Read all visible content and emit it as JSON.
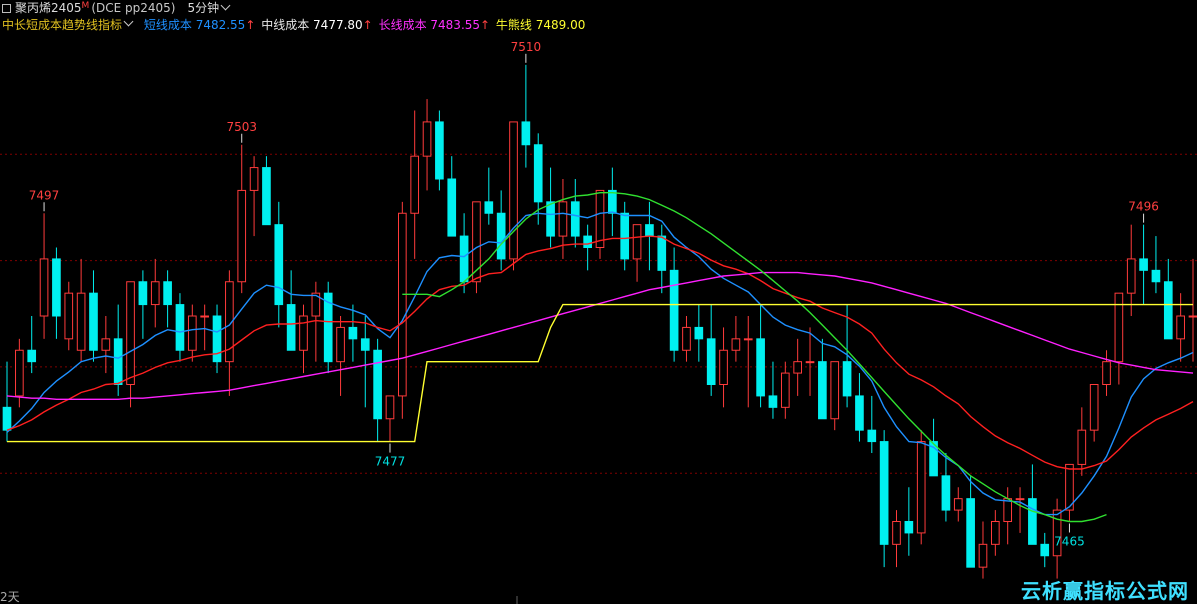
{
  "header": {
    "instrument": "聚丙烯2405",
    "flag": "M",
    "code": "(DCE pp2405)",
    "period": "5分钟"
  },
  "indicator": {
    "name": "中长短成本趋势线指标",
    "short_label": "短线成本",
    "short_value": "7482.55",
    "short_arrow": "↑",
    "mid_label": "中线成本",
    "mid_value": "7477.80",
    "mid_arrow": "↑",
    "long_label": "长线成本",
    "long_value": "7483.55",
    "long_arrow": "↑",
    "bull_label": "牛熊线",
    "bull_value": "7489.00"
  },
  "bottom_label": "2天",
  "watermark": "云析赢指标公式网",
  "colors": {
    "up": "#ff3b3b",
    "down": "#00f0f0",
    "short_line": "#1e90ff",
    "mid_line": "#ff2020",
    "long_line": "#ff20ff",
    "trend_line": "#30e030",
    "bull_line": "#ffff30",
    "grid": "#800000"
  },
  "chart_data": {
    "type": "candlestick",
    "ylim": [
      7464,
      7512
    ],
    "annotations": [
      {
        "label": "7497",
        "index": 3
      },
      {
        "label": "7503",
        "index": 19
      },
      {
        "label": "7477",
        "index": 31
      },
      {
        "label": "7510",
        "index": 42
      },
      {
        "label": "7465",
        "index": 86
      },
      {
        "label": "7496",
        "index": 92
      }
    ],
    "candles": [
      [
        7480,
        7484,
        7477,
        7478
      ],
      [
        7481,
        7486,
        7480,
        7485
      ],
      [
        7485,
        7488,
        7483,
        7484
      ],
      [
        7488,
        7497,
        7486,
        7493
      ],
      [
        7493,
        7494,
        7486,
        7488
      ],
      [
        7486,
        7491,
        7485,
        7490
      ],
      [
        7485,
        7493,
        7484,
        7490
      ],
      [
        7490,
        7492,
        7484,
        7485
      ],
      [
        7485,
        7488,
        7483,
        7486
      ],
      [
        7486,
        7489,
        7481,
        7482
      ],
      [
        7482,
        7491,
        7480,
        7491
      ],
      [
        7491,
        7492,
        7486,
        7489
      ],
      [
        7489,
        7493,
        7487,
        7491
      ],
      [
        7491,
        7492,
        7487,
        7489
      ],
      [
        7489,
        7490,
        7484,
        7485
      ],
      [
        7485,
        7489,
        7484,
        7488
      ],
      [
        7488,
        7489,
        7485,
        7488
      ],
      [
        7488,
        7489,
        7483,
        7484
      ],
      [
        7484,
        7492,
        7481,
        7491
      ],
      [
        7491,
        7503,
        7490,
        7499
      ],
      [
        7499,
        7502,
        7495,
        7501
      ],
      [
        7501,
        7502,
        7496,
        7496
      ],
      [
        7496,
        7498,
        7487,
        7489
      ],
      [
        7489,
        7492,
        7485,
        7485
      ],
      [
        7485,
        7489,
        7483,
        7488
      ],
      [
        7488,
        7491,
        7484,
        7490
      ],
      [
        7490,
        7491,
        7483,
        7484
      ],
      [
        7484,
        7488,
        7481,
        7487
      ],
      [
        7487,
        7489,
        7484,
        7486
      ],
      [
        7486,
        7488,
        7480,
        7485
      ],
      [
        7485,
        7486,
        7477,
        7479
      ],
      [
        7479,
        7481,
        7477,
        7481
      ],
      [
        7481,
        7498,
        7479,
        7497
      ],
      [
        7497,
        7506,
        7493,
        7502
      ],
      [
        7502,
        7507,
        7499,
        7505
      ],
      [
        7505,
        7506,
        7499,
        7500
      ],
      [
        7500,
        7502,
        7495,
        7495
      ],
      [
        7495,
        7497,
        7490,
        7491
      ],
      [
        7491,
        7498,
        7490,
        7498
      ],
      [
        7498,
        7501,
        7496,
        7497
      ],
      [
        7497,
        7499,
        7492,
        7493
      ],
      [
        7493,
        7505,
        7492,
        7505
      ],
      [
        7505,
        7510,
        7501,
        7503
      ],
      [
        7503,
        7504,
        7496,
        7498
      ],
      [
        7498,
        7501,
        7494,
        7495
      ],
      [
        7495,
        7500,
        7493,
        7498
      ],
      [
        7498,
        7500,
        7494,
        7495
      ],
      [
        7495,
        7496,
        7492,
        7494
      ],
      [
        7494,
        7499,
        7493,
        7499
      ],
      [
        7499,
        7501,
        7495,
        7497
      ],
      [
        7497,
        7498,
        7492,
        7493
      ],
      [
        7493,
        7496,
        7491,
        7496
      ],
      [
        7496,
        7498,
        7492,
        7495
      ],
      [
        7495,
        7496,
        7490,
        7492
      ],
      [
        7492,
        7494,
        7484,
        7485
      ],
      [
        7485,
        7488,
        7484,
        7487
      ],
      [
        7487,
        7489,
        7484,
        7486
      ],
      [
        7486,
        7489,
        7481,
        7482
      ],
      [
        7482,
        7487,
        7480,
        7485
      ],
      [
        7485,
        7488,
        7484,
        7486
      ],
      [
        7486,
        7488,
        7480,
        7486
      ],
      [
        7486,
        7489,
        7480,
        7481
      ],
      [
        7481,
        7484,
        7479,
        7480
      ],
      [
        7480,
        7484,
        7479,
        7483
      ],
      [
        7483,
        7486,
        7481,
        7484
      ],
      [
        7484,
        7487,
        7481,
        7484
      ],
      [
        7484,
        7486,
        7479,
        7479
      ],
      [
        7479,
        7484,
        7478,
        7484
      ],
      [
        7484,
        7489,
        7480,
        7481
      ],
      [
        7481,
        7483,
        7477,
        7478
      ],
      [
        7478,
        7481,
        7476,
        7477
      ],
      [
        7477,
        7478,
        7466,
        7468
      ],
      [
        7468,
        7471,
        7466,
        7470
      ],
      [
        7470,
        7473,
        7467,
        7469
      ],
      [
        7469,
        7478,
        7468,
        7477
      ],
      [
        7477,
        7479,
        7474,
        7474
      ],
      [
        7474,
        7476,
        7470,
        7471
      ],
      [
        7471,
        7473,
        7470,
        7472
      ],
      [
        7472,
        7474,
        7466,
        7466
      ],
      [
        7466,
        7470,
        7465,
        7468
      ],
      [
        7468,
        7471,
        7467,
        7470
      ],
      [
        7470,
        7473,
        7468,
        7472
      ],
      [
        7472,
        7473,
        7469,
        7472
      ],
      [
        7472,
        7475,
        7468,
        7468
      ],
      [
        7468,
        7469,
        7466,
        7467
      ],
      [
        7467,
        7472,
        7465,
        7471
      ],
      [
        7471,
        7475,
        7470,
        7475
      ],
      [
        7475,
        7480,
        7474,
        7478
      ],
      [
        7478,
        7481,
        7477,
        7482
      ],
      [
        7482,
        7485,
        7481,
        7484
      ],
      [
        7484,
        7490,
        7482,
        7490
      ],
      [
        7490,
        7496,
        7488,
        7493
      ],
      [
        7493,
        7496,
        7489,
        7492
      ],
      [
        7492,
        7495,
        7490,
        7491
      ],
      [
        7491,
        7493,
        7486,
        7486
      ],
      [
        7486,
        7490,
        7484,
        7488
      ],
      [
        7488,
        7493,
        7484,
        7488
      ]
    ],
    "series": [
      {
        "name": "短线成本",
        "values": [
          7477.8,
          7478.8,
          7479.9,
          7481.3,
          7482.3,
          7483.1,
          7484.0,
          7484.3,
          7484.5,
          7484.3,
          7484.9,
          7485.5,
          7486.3,
          7486.8,
          7486.6,
          7486.8,
          7486.9,
          7486.6,
          7487.2,
          7488.6,
          7490.0,
          7490.7,
          7490.5,
          7489.9,
          7489.8,
          7489.8,
          7489.2,
          7488.8,
          7488.5,
          7488.1,
          7486.9,
          7486.1,
          7487.6,
          7489.7,
          7491.9,
          7493.1,
          7493.3,
          7493.2,
          7494.0,
          7494.5,
          7494.4,
          7495.7,
          7496.8,
          7497.0,
          7496.9,
          7497.0,
          7496.8,
          7496.6,
          7497.0,
          7497.1,
          7496.8,
          7496.8,
          7496.8,
          7496.3,
          7494.9,
          7494.0,
          7493.2,
          7492.1,
          7491.3,
          7490.7,
          7490.1,
          7489.0,
          7487.9,
          7487.2,
          7486.8,
          7486.5,
          7485.6,
          7485.3,
          7484.6,
          7483.6,
          7482.3,
          7480.0,
          7478.3,
          7477.0,
          7476.9,
          7476.5,
          7475.6,
          7474.9,
          7473.5,
          7472.5,
          7471.9,
          7471.8,
          7471.7,
          7471.1,
          7470.6,
          7470.6,
          7471.3,
          7472.5,
          7474.0,
          7475.7,
          7478.2,
          7480.9,
          7482.5,
          7483.4,
          7483.9,
          7484.3,
          7484.8
        ]
      },
      {
        "name": "中线成本",
        "values": [
          7478.0,
          7478.4,
          7478.9,
          7479.6,
          7480.2,
          7480.7,
          7481.3,
          7481.6,
          7482.0,
          7482.1,
          7482.6,
          7483.0,
          7483.5,
          7483.9,
          7484.1,
          7484.4,
          7484.6,
          7484.7,
          7485.1,
          7485.9,
          7486.7,
          7487.2,
          7487.3,
          7487.3,
          7487.4,
          7487.6,
          7487.5,
          7487.5,
          7487.5,
          7487.4,
          7487.0,
          7486.7,
          7487.4,
          7488.4,
          7489.5,
          7490.3,
          7490.6,
          7490.7,
          7491.3,
          7491.7,
          7491.8,
          7492.6,
          7493.4,
          7493.7,
          7493.9,
          7494.2,
          7494.3,
          7494.3,
          7494.6,
          7494.8,
          7494.8,
          7494.9,
          7495.0,
          7494.9,
          7494.3,
          7493.9,
          7493.5,
          7492.9,
          7492.4,
          7492.1,
          7491.7,
          7491.1,
          7490.4,
          7490.0,
          7489.6,
          7489.3,
          7488.7,
          7488.3,
          7487.9,
          7487.3,
          7486.5,
          7485.1,
          7483.9,
          7482.9,
          7482.4,
          7481.8,
          7481.0,
          7480.3,
          7479.2,
          7478.3,
          7477.5,
          7476.9,
          7476.4,
          7475.8,
          7475.2,
          7474.8,
          7474.6,
          7474.6,
          7474.9,
          7475.3,
          7476.3,
          7477.4,
          7478.2,
          7478.9,
          7479.4,
          7479.9,
          7480.5
        ]
      },
      {
        "name": "长线成本",
        "values": [
          7481.0,
          7480.9,
          7480.8,
          7480.8,
          7480.7,
          7480.7,
          7480.7,
          7480.7,
          7480.7,
          7480.7,
          7480.8,
          7480.8,
          7480.9,
          7481.0,
          7481.1,
          7481.2,
          7481.3,
          7481.4,
          7481.5,
          7481.7,
          7481.9,
          7482.1,
          7482.3,
          7482.5,
          7482.7,
          7482.9,
          7483.1,
          7483.3,
          7483.5,
          7483.7,
          7483.9,
          7484.1,
          7484.3,
          7484.6,
          7484.9,
          7485.2,
          7485.5,
          7485.8,
          7486.1,
          7486.4,
          7486.7,
          7487.0,
          7487.3,
          7487.6,
          7487.9,
          7488.2,
          7488.5,
          7488.8,
          7489.1,
          7489.4,
          7489.7,
          7490.0,
          7490.3,
          7490.5,
          7490.7,
          7490.9,
          7491.1,
          7491.3,
          7491.5,
          7491.6,
          7491.7,
          7491.8,
          7491.8,
          7491.8,
          7491.8,
          7491.7,
          7491.6,
          7491.5,
          7491.3,
          7491.1,
          7490.9,
          7490.6,
          7490.3,
          7490.0,
          7489.7,
          7489.4,
          7489.1,
          7488.7,
          7488.3,
          7487.9,
          7487.5,
          7487.1,
          7486.7,
          7486.3,
          7485.9,
          7485.5,
          7485.1,
          7484.8,
          7484.5,
          7484.2,
          7483.9,
          7483.7,
          7483.5,
          7483.3,
          7483.2,
          7483.1,
          7483.0
        ]
      },
      {
        "name": "trend",
        "values": [
          null,
          null,
          null,
          null,
          null,
          null,
          null,
          null,
          null,
          null,
          null,
          null,
          null,
          null,
          null,
          null,
          null,
          null,
          null,
          null,
          null,
          null,
          null,
          null,
          null,
          null,
          null,
          null,
          null,
          null,
          null,
          null,
          7489.9,
          7489.9,
          7489.9,
          7489.7,
          7490.3,
          7491.0,
          7492.0,
          7493.0,
          7494.3,
          7495.4,
          7496.5,
          7497.3,
          7497.8,
          7498.2,
          7498.5,
          7498.6,
          7498.8,
          7498.8,
          7498.7,
          7498.5,
          7498.2,
          7497.7,
          7497.2,
          7496.6,
          7495.9,
          7495.2,
          7494.4,
          7493.6,
          7492.8,
          7492.0,
          7491.1,
          7490.2,
          7489.3,
          7488.3,
          7487.2,
          7486.1,
          7485.0,
          7483.8,
          7482.6,
          7481.4,
          7480.2,
          7479.0,
          7477.9,
          7476.8,
          7475.8,
          7474.9,
          7474.0,
          7473.3,
          7472.6,
          7472.0,
          7471.4,
          7470.9,
          7470.6,
          7470.2,
          7470.0,
          7470.0,
          7470.2,
          7470.6,
          null,
          null,
          null,
          null,
          null,
          null,
          null
        ]
      },
      {
        "name": "牛熊线",
        "values": [
          7477,
          7477,
          7477,
          7477,
          7477,
          7477,
          7477,
          7477,
          7477,
          7477,
          7477,
          7477,
          7477,
          7477,
          7477,
          7477,
          7477,
          7477,
          7477,
          7477,
          7477,
          7477,
          7477,
          7477,
          7477,
          7477,
          7477,
          7477,
          7477,
          7477,
          7477,
          7477,
          7477,
          7477,
          7484,
          7484,
          7484,
          7484,
          7484,
          7484,
          7484,
          7484,
          7484,
          7484,
          7487,
          7489,
          7489,
          7489,
          7489,
          7489,
          7489,
          7489,
          7489,
          7489,
          7489,
          7489,
          7489,
          7489,
          7489,
          7489,
          7489,
          7489,
          7489,
          7489,
          7489,
          7489,
          7489,
          7489,
          7489,
          7489,
          7489,
          7489,
          7489,
          7489,
          7489,
          7489,
          7489,
          7489,
          7489,
          7489,
          7489,
          7489,
          7489,
          7489,
          7489,
          7489,
          7489,
          7489,
          7489,
          7489,
          7489,
          7489,
          7489,
          7489,
          7489,
          7489,
          7489
        ]
      }
    ]
  }
}
